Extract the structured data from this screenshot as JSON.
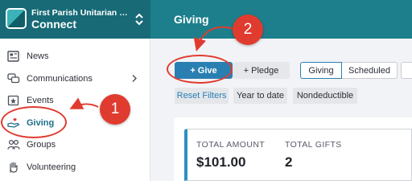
{
  "header": {
    "org_name": "First Parish Unitarian Universalist",
    "app_name": "Connect",
    "page_title": "Giving"
  },
  "sidebar": {
    "items": [
      {
        "label": "News",
        "icon": "news-icon"
      },
      {
        "label": "Communications",
        "icon": "chat-icon"
      },
      {
        "label": "Events",
        "icon": "calendar-star-icon"
      },
      {
        "label": "Giving",
        "icon": "hand-heart-icon"
      },
      {
        "label": "Groups",
        "icon": "people-icon"
      },
      {
        "label": "Volunteering",
        "icon": "raised-hand-icon"
      }
    ],
    "active": "Giving"
  },
  "toolbar": {
    "give_label": "+ Give",
    "pledge_label": "+ Pledge",
    "tabs": [
      "Giving",
      "Scheduled"
    ],
    "selected_tab": "Giving"
  },
  "filters": [
    "Reset Filters",
    "Year to date",
    "Nondeductible"
  ],
  "summary": {
    "total_amount_label": "TOTAL AMOUNT",
    "total_amount_value": "$101.00",
    "total_gifts_label": "TOTAL GIFTS",
    "total_gifts_value": "2"
  },
  "annotations": {
    "step_1": "1",
    "step_2": "2"
  },
  "colors": {
    "header": "#1d7f8c",
    "accent": "#2a7fb2",
    "callout": "#e03b2f"
  }
}
